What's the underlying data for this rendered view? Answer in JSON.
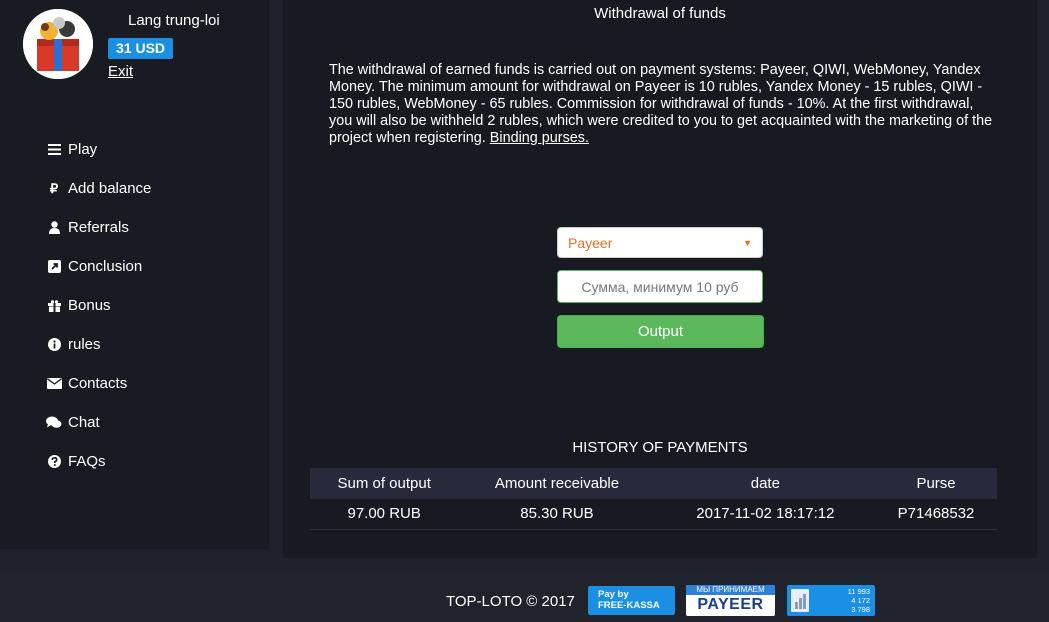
{
  "user": {
    "name": "Lang trung-loi",
    "balance": "31 USD",
    "exit_label": "Exit"
  },
  "nav": {
    "items": [
      {
        "label": "Play",
        "icon": "list-icon"
      },
      {
        "label": "Add balance",
        "icon": "ruble-icon"
      },
      {
        "label": "Referrals",
        "icon": "user-icon"
      },
      {
        "label": "Conclusion",
        "icon": "external-link-icon"
      },
      {
        "label": "Bonus",
        "icon": "gift-icon"
      },
      {
        "label": "rules",
        "icon": "info-icon"
      },
      {
        "label": "Contacts",
        "icon": "envelope-icon"
      },
      {
        "label": "Chat",
        "icon": "chat-icon"
      },
      {
        "label": "FAQs",
        "icon": "question-icon"
      }
    ]
  },
  "main": {
    "title": "Withdrawal of funds",
    "info_text": "The withdrawal of earned funds is carried out on payment systems: Payeer, QIWI, WebMoney, Yandex Money. The minimum amount for withdrawal on Payeer is 10 rubles, Yandex Money - 15 rubles, QIWI - 150 rubles, WebMoney - 65 rubles. Commission for withdrawal of funds - 10%. At the first withdrawal, you will also be withheld 2 rubles, which were credited to you to get acquainted with the marketing of the project when registering.",
    "binding_link": "Binding purses.",
    "payment_select": "Payeer",
    "amount_placeholder": "Сумма, минимум 10 руб",
    "output_button": "Output"
  },
  "history": {
    "title": "HISTORY OF PAYMENTS",
    "columns": [
      "Sum of output",
      "Amount receivable",
      "date",
      "Purse"
    ],
    "rows": [
      [
        "97.00 RUB",
        "85.30 RUB",
        "2017-11-02 18:17:12",
        "P71468532"
      ]
    ]
  },
  "footer": {
    "copyright": "TOP-LOTO © 2017",
    "freekassa_line1": "Pay by",
    "freekassa_line2": "FREE-KASSA",
    "payeer_top": "МЫ ПРИНИМАЕМ",
    "payeer_name": "PAYEER",
    "counter_line1": "11 993",
    "counter_line2": "4 172",
    "counter_line3": "3 798"
  },
  "colors": {
    "background": "#1e2129",
    "sidebar": "#181b22",
    "panel": "#171a21",
    "accent_blue": "#1a8fe3",
    "button_green": "#5cb85c",
    "select_text": "#e07020"
  }
}
